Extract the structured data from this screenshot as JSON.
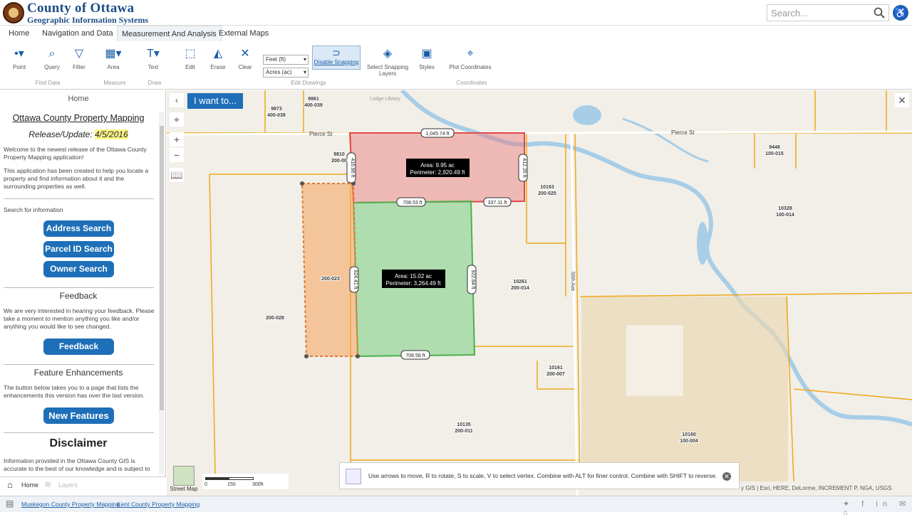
{
  "header": {
    "brand_line1": "County of Ottawa",
    "brand_line2": "Geographic Information Systems",
    "search_placeholder": "Search...",
    "accessibility_glyph": "♿"
  },
  "tabs": [
    {
      "label": "Home"
    },
    {
      "label": "Navigation and Data"
    },
    {
      "label": "Measurement And Analysis",
      "active": true
    },
    {
      "label": "External Maps"
    }
  ],
  "ribbon": {
    "point": "Point",
    "query": "Query",
    "filter": "Filter",
    "area": "Area",
    "text": "Text",
    "edit": "Edit",
    "erase": "Erase",
    "clear": "Clear",
    "length_unit": "Feet (ft)",
    "area_unit": "Acres (ac)",
    "disable_snapping": "Disable Snapping",
    "select_snapping_layers": "Select Snapping Layers",
    "styles": "Styles",
    "plot_coordinates": "Plot Coordinates",
    "group_find_data": "Find Data",
    "group_measure": "Measure",
    "group_draw": "Draw",
    "group_edit_drawings": "Edit Drawings",
    "group_coordinates": "Coordinates"
  },
  "sidebar": {
    "home_title": "Home",
    "app_title": "Ottawa County Property Mapping",
    "release_label": "Release/Update:",
    "release_date": "4/5/2016",
    "welcome": "Welcome to the newest release of the Ottawa County Property Mapping application!",
    "intro": "This application has been created to help you locate a property and find information about it and the surrounding properties as well.",
    "search_label": "Search for information",
    "address_search": "Address Search",
    "parcel_search": "Parcel ID Search",
    "owner_search": "Owner Search",
    "feedback_title": "Feedback",
    "feedback_text": "We are very interested in hearing your feedback. Please take a moment to mention anything you like and/or anything you would like to see changed.",
    "feedback_button": "Feedback",
    "features_title": "Feature Enhancements",
    "features_text": "The button below takes you to a page that lists the enhancements this version has over the last version.",
    "features_button": "New Features",
    "disclaimer_title": "Disclaimer",
    "disclaimer_text": "Information provided in the Ottawa County GIS is accurate to the best of our knowledge and is subject to"
  },
  "bottomnav": {
    "home": "Home",
    "layers": "Layers"
  },
  "footer": {
    "link1": "Muskegon County Property Mapping",
    "link2": "Kent County Property Mapping"
  },
  "map": {
    "i_want_to": "I want to...",
    "street": "Pierce St",
    "street2": "Pierce St",
    "road_vertical": "56th Ave",
    "lodge": "Lodge Library",
    "red_area": "Area: 9.95 ac",
    "red_perimeter": "Perimeter: 2,920.49 ft",
    "green_area": "Area: 15.02 ac",
    "green_perimeter": "Perimeter: 3,264.49 ft",
    "dim_red_top": "1,045.74 ft",
    "dim_red_right": "412.26 ft",
    "dim_red_left": "416.86 ft",
    "dim_red_bottom": "708.53 ft",
    "dim_red_bottom_right": "337.11 ft",
    "dim_green_right": "922.84 ft",
    "dim_green_left": "924.41 ft",
    "dim_green_bottom": "708.58 ft",
    "tip": "Use arrows to move, R to rotate, S to scale, V to select vertex. Combine with ALT for finer control. Combine with SHIFT to reverse.",
    "basemap": "Street Map",
    "scale_0": "0",
    "scale_1": "150",
    "scale_2": "300ft",
    "attribution": "y GIS | Esri, HERE, DeLorme, INCREMENT P, NGA, USGS",
    "parcels": [
      {
        "a": "9873",
        "b": "400-038"
      },
      {
        "a": "9861",
        "b": "400-039"
      },
      {
        "a": "9810",
        "b": "200-00"
      },
      {
        "a": "9448",
        "b": "100-015"
      },
      {
        "a": "10163",
        "b": "200-025"
      },
      {
        "a": "10328",
        "b": "100-014"
      },
      {
        "a": "",
        "b": "200-023"
      },
      {
        "a": "",
        "b": "200-028"
      },
      {
        "a": "10261",
        "b": "200-014"
      },
      {
        "a": "10161",
        "b": "200-007"
      },
      {
        "a": "10135",
        "b": "200-011"
      },
      {
        "a": "10160",
        "b": "100-004"
      }
    ]
  }
}
